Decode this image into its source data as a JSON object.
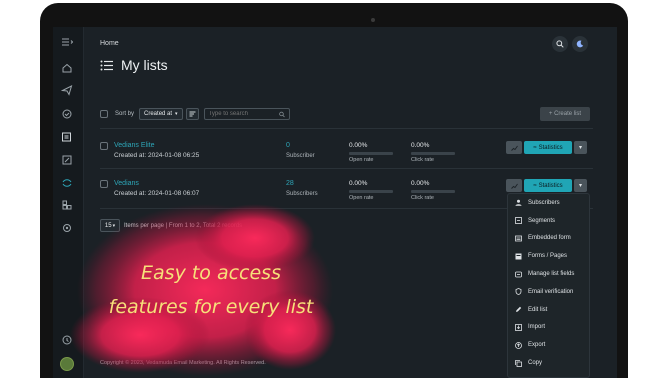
{
  "breadcrumb": "Home",
  "page_title": "My lists",
  "toolbar": {
    "sort_label": "Sort by",
    "sort_value": "Created at",
    "search_placeholder": "Type to search",
    "create_label": "+ Create list"
  },
  "lists": [
    {
      "name": "Vedians Elite",
      "created": "Created at: 2024-01-08 06:25",
      "subscribers": "0",
      "subscribers_label": "Subscriber",
      "open_rate": "0.00%",
      "open_rate_label": "Open rate",
      "click_rate": "0.00%",
      "click_rate_label": "Click rate",
      "stats_label": "Statistics"
    },
    {
      "name": "Vedians",
      "created": "Created at: 2024-01-08 06:07",
      "subscribers": "28",
      "subscribers_label": "Subscribers",
      "open_rate": "0.00%",
      "open_rate_label": "Open rate",
      "click_rate": "0.00%",
      "click_rate_label": "Click rate",
      "stats_label": "Statistics"
    }
  ],
  "pagination": {
    "per_page": "15",
    "text": "Items per page | From 1 to 2, Total 2 records"
  },
  "menu": [
    {
      "label": "Subscribers",
      "icon": "subscribers-icon"
    },
    {
      "label": "Segments",
      "icon": "segments-icon"
    },
    {
      "label": "Embedded form",
      "icon": "embedded-form-icon"
    },
    {
      "label": "Forms / Pages",
      "icon": "forms-pages-icon"
    },
    {
      "label": "Manage list fields",
      "icon": "list-fields-icon"
    },
    {
      "label": "Email verification",
      "icon": "shield-icon"
    },
    {
      "label": "Edit list",
      "icon": "pencil-icon"
    },
    {
      "label": "Import",
      "icon": "import-icon"
    },
    {
      "label": "Export",
      "icon": "export-icon"
    },
    {
      "label": "Copy",
      "icon": "copy-icon"
    }
  ],
  "footer": "Copyright © 2023, Vedamuda Email Marketing. All Rights Reserved.",
  "promo": {
    "line1": "Easy to access",
    "line2": "features for every list"
  },
  "colors": {
    "accent": "#20a5b5",
    "link": "#2ea6b8",
    "background": "#1b2126",
    "promo_text": "#f7e07a",
    "splash": "#e0204f"
  }
}
